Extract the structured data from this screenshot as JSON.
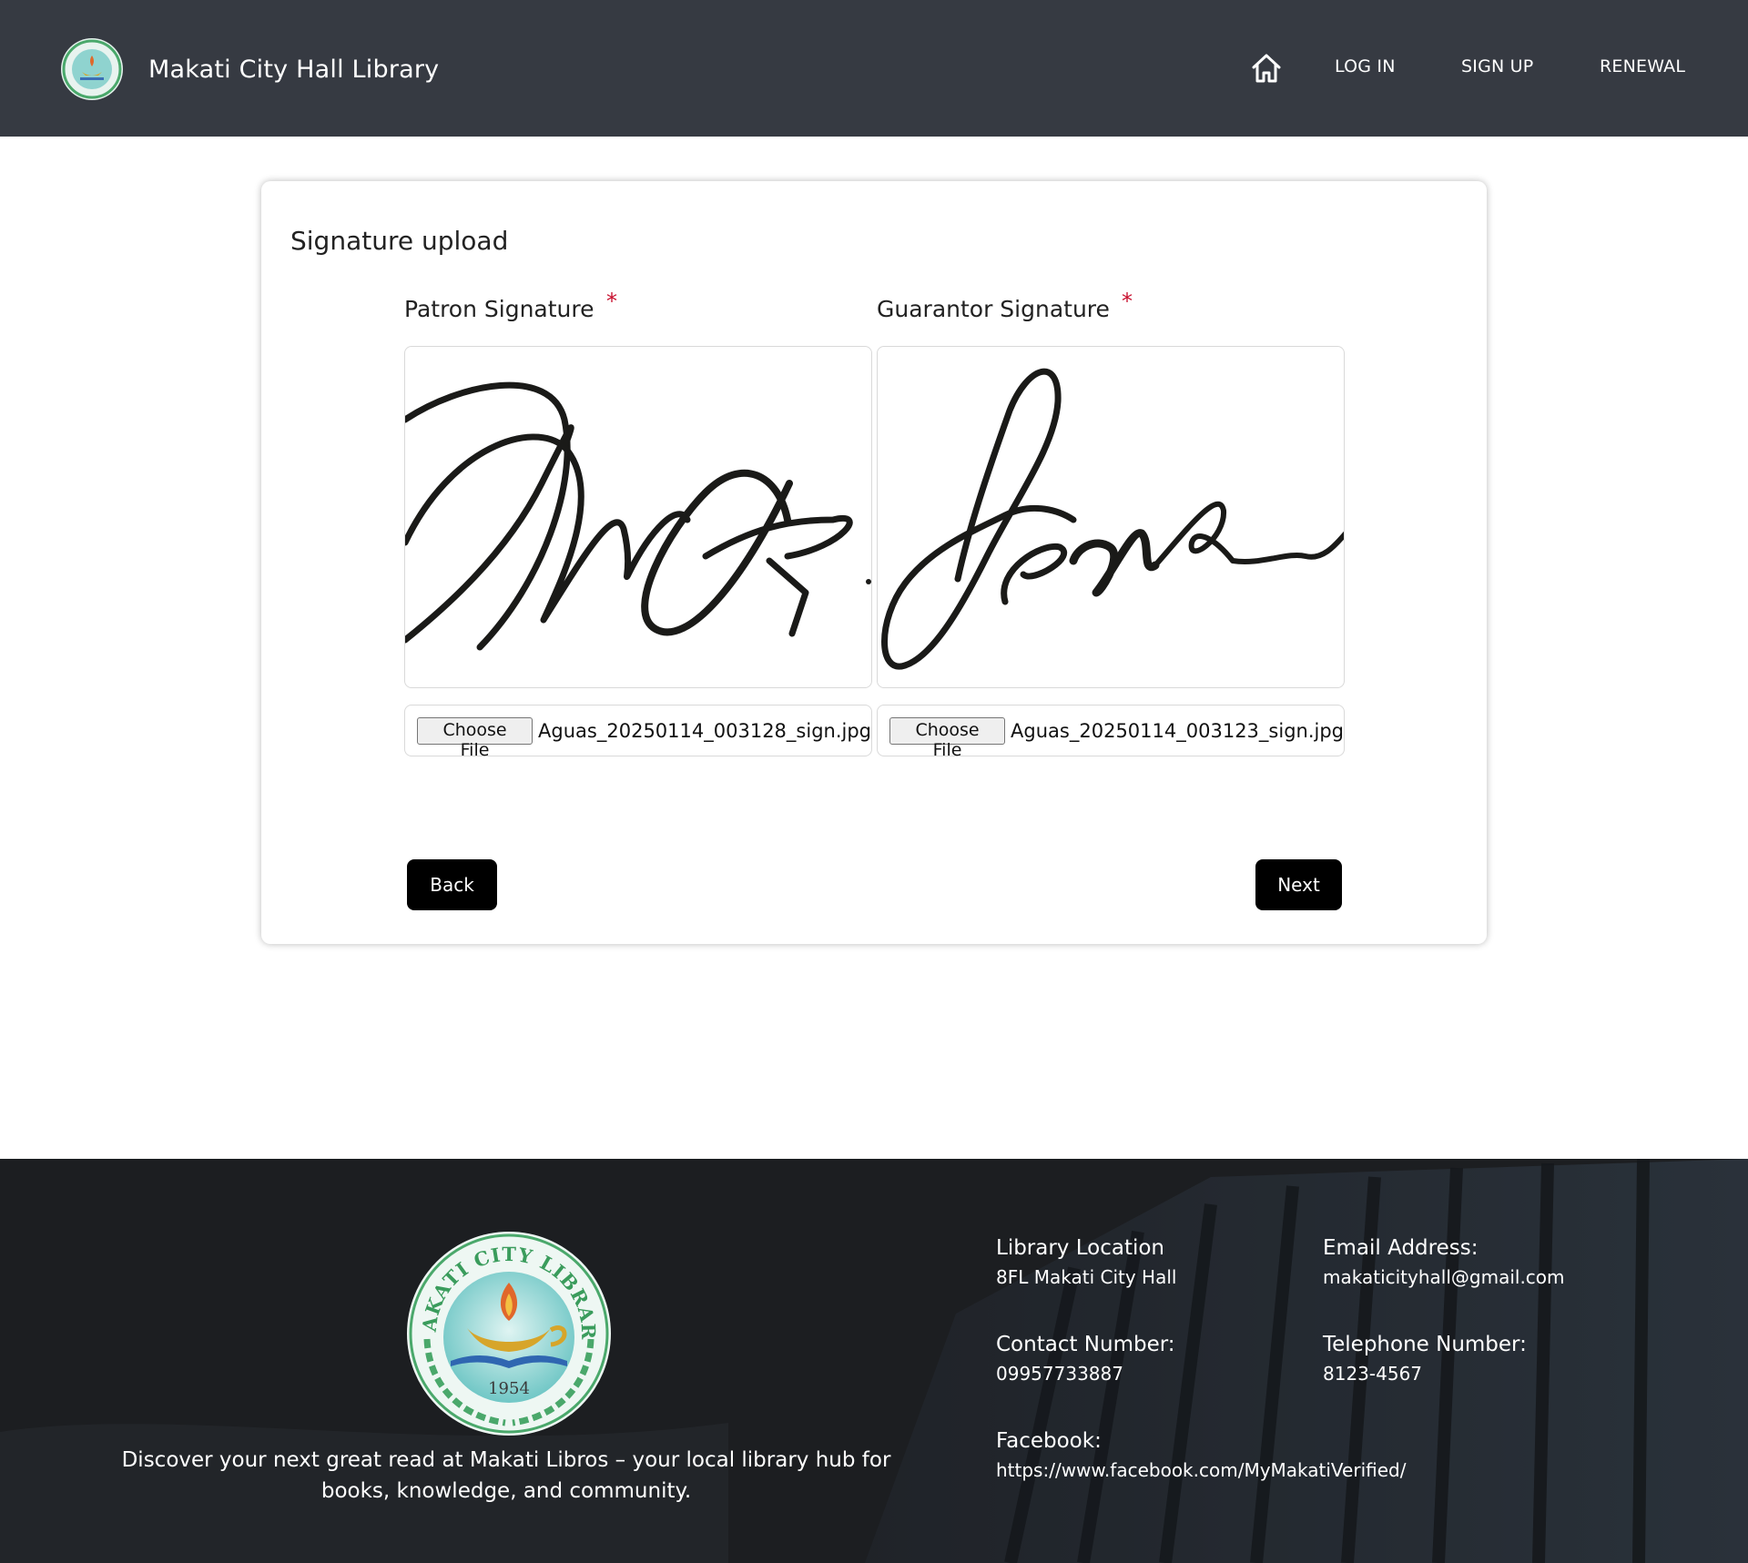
{
  "header": {
    "brand_title": "Makati City Hall Library",
    "nav": {
      "home_icon": "home-icon",
      "login": "LOG IN",
      "signup": "SIGN UP",
      "renewal": "RENEWAL"
    }
  },
  "form": {
    "title": "Signature upload",
    "required_marker": "*",
    "patron": {
      "label": "Patron Signature",
      "choose_file_label": "Choose File",
      "file_name": "Aguas_20250114_003128_sign.jpg"
    },
    "guarantor": {
      "label": "Guarantor Signature",
      "choose_file_label": "Choose File",
      "file_name": "Aguas_20250114_003123_sign.jpg"
    },
    "back_label": "Back",
    "next_label": "Next"
  },
  "footer": {
    "description": "Discover your next great read at Makati Libros – your local library hub for books, knowledge, and community.",
    "logo_text_arc": "MAKATI CITY LIBRARY",
    "logo_year": "1954",
    "library_location_label": "Library Location",
    "library_location_value": "8FL Makati City Hall",
    "email_label": "Email Address:",
    "email_value": "makaticityhall@gmail.com",
    "contact_label": "Contact Number:",
    "contact_value": "09957733887",
    "telephone_label": "Telephone Number:",
    "telephone_value": "8123-4567",
    "facebook_label": "Facebook:",
    "facebook_value": "https://www.facebook.com/MyMakatiVerified/"
  },
  "colors": {
    "header_bg": "#363a42",
    "required": "#c8102e",
    "button_bg": "#000000"
  }
}
